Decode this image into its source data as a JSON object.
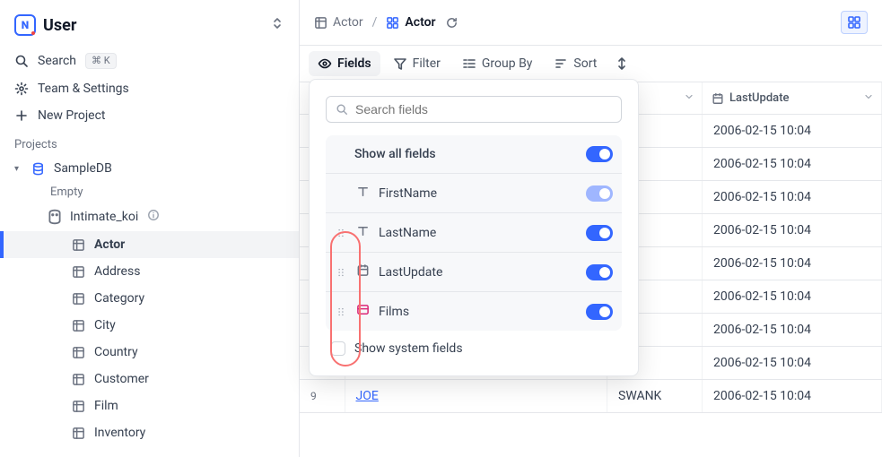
{
  "sidebar": {
    "brand": "User",
    "search_label": "Search",
    "search_kbd": "⌘ K",
    "team_label": "Team & Settings",
    "newproj_label": "New Project",
    "projects_label": "Projects"
  },
  "tree": {
    "db": "SampleDB",
    "empty": "Empty",
    "group": "Intimate_koi",
    "tables": [
      "Actor",
      "Address",
      "Category",
      "City",
      "Country",
      "Customer",
      "Film",
      "Inventory"
    ],
    "active_table": "Actor"
  },
  "crumbs": {
    "table": "Actor",
    "view": "Actor"
  },
  "toolbar": {
    "fields": "Fields",
    "filter": "Filter",
    "groupby": "Group By",
    "sort": "Sort"
  },
  "columns": {
    "lastname": "LastName",
    "lastupdate": "LastUpdate"
  },
  "rows": [
    {
      "num": "",
      "first": "",
      "last": "",
      "lu": "2006-02-15 10:04"
    },
    {
      "num": "",
      "first": "",
      "last": "",
      "lu": "2006-02-15 10:04"
    },
    {
      "num": "",
      "first": "",
      "last": "",
      "lu": "2006-02-15 10:04"
    },
    {
      "num": "",
      "first": "",
      "last": "",
      "lu": "2006-02-15 10:04"
    },
    {
      "num": "",
      "first": "",
      "last": "",
      "lu": "2006-02-15 10:04"
    },
    {
      "num": "",
      "first": "",
      "last": "",
      "lu": "2006-02-15 10:04"
    },
    {
      "num": "",
      "first": "",
      "last": "",
      "lu": "2006-02-15 10:04"
    },
    {
      "num": "",
      "first": "",
      "last": "",
      "lu": "2006-02-15 10:04"
    },
    {
      "num": "9",
      "first": "JOE",
      "last": "SWANK",
      "lu": "2006-02-15 10:04"
    }
  ],
  "popover": {
    "search_placeholder": "Search fields",
    "show_all": "Show all fields",
    "show_all_on": true,
    "fields": [
      {
        "name": "FirstName",
        "type": "text",
        "on": true,
        "muted": true,
        "drag": false
      },
      {
        "name": "LastName",
        "type": "text",
        "on": true,
        "muted": false,
        "drag": true
      },
      {
        "name": "LastUpdate",
        "type": "date",
        "on": true,
        "muted": false,
        "drag": true
      },
      {
        "name": "Films",
        "type": "link",
        "on": true,
        "muted": false,
        "drag": true
      }
    ],
    "show_system": "Show system fields"
  }
}
